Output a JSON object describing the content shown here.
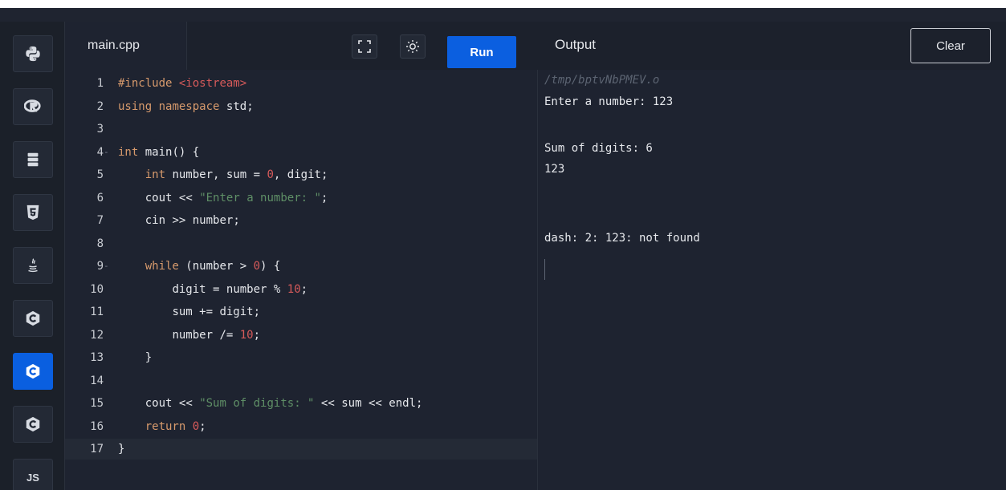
{
  "sidebar": {
    "items": [
      {
        "icon": "python-icon"
      },
      {
        "icon": "r-icon"
      },
      {
        "icon": "database-icon"
      },
      {
        "icon": "html5-icon"
      },
      {
        "icon": "java-icon"
      },
      {
        "icon": "c-icon"
      },
      {
        "icon": "cpp-icon",
        "active": true
      },
      {
        "icon": "csharp-icon"
      },
      {
        "icon": "js-icon",
        "label": "JS"
      }
    ]
  },
  "editor": {
    "file_tab": "main.cpp",
    "run_label": "Run",
    "lines": [
      {
        "n": "1",
        "fold": "",
        "code": "#include <iostream>"
      },
      {
        "n": "2",
        "fold": "",
        "code": "using namespace std;"
      },
      {
        "n": "3",
        "fold": "",
        "code": ""
      },
      {
        "n": "4",
        "fold": "-",
        "code": "int main() {"
      },
      {
        "n": "5",
        "fold": "",
        "code": "    int number, sum = 0, digit;"
      },
      {
        "n": "6",
        "fold": "",
        "code": "    cout << \"Enter a number: \";"
      },
      {
        "n": "7",
        "fold": "",
        "code": "    cin >> number;"
      },
      {
        "n": "8",
        "fold": "",
        "code": ""
      },
      {
        "n": "9",
        "fold": "-",
        "code": "    while (number > 0) {"
      },
      {
        "n": "10",
        "fold": "",
        "code": "        digit = number % 10;"
      },
      {
        "n": "11",
        "fold": "",
        "code": "        sum += digit;"
      },
      {
        "n": "12",
        "fold": "",
        "code": "        number /= 10;"
      },
      {
        "n": "13",
        "fold": "",
        "code": "    }"
      },
      {
        "n": "14",
        "fold": "",
        "code": ""
      },
      {
        "n": "15",
        "fold": "",
        "code": "    cout << \"Sum of digits: \" << sum << endl;"
      },
      {
        "n": "16",
        "fold": "",
        "code": "    return 0;"
      },
      {
        "n": "17",
        "fold": "",
        "code": "}"
      }
    ]
  },
  "output": {
    "title": "Output",
    "clear_label": "Clear",
    "path": "/tmp/bptvNbPMEV.o",
    "lines": [
      "Enter a number: 123",
      "",
      "Sum of digits: 6",
      "123",
      "",
      "",
      "dash: 2: 123: not found"
    ]
  },
  "colors": {
    "accent": "#0b5fe0",
    "background": "#1e2330",
    "keyword": "#d79a6c",
    "string": "#5f8f66",
    "number": "#d65a5a"
  }
}
